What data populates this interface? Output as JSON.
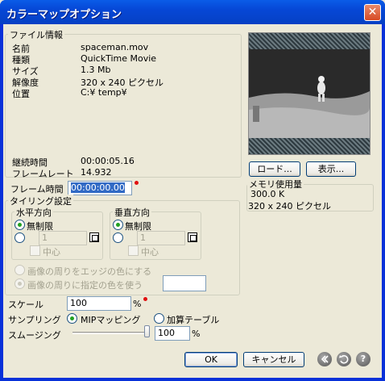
{
  "window": {
    "title": "カラーマップオプション",
    "close_glyph": "✕"
  },
  "file_info": {
    "legend": "ファイル情報",
    "rows": [
      {
        "label": "名前",
        "value": "spaceman.mov"
      },
      {
        "label": "種類",
        "value": "QuickTime Movie"
      },
      {
        "label": "サイズ",
        "value": "1.3 Mb"
      },
      {
        "label": "解像度",
        "value": "320 x 240 ピクセル"
      },
      {
        "label": "位置",
        "value": "C:¥ temp¥"
      }
    ],
    "duration_label": "継続時間",
    "duration_value": "00:00:05.16",
    "framerate_label": "フレームレート",
    "framerate_value": "14.932"
  },
  "preview": {
    "load_label": "ロード...",
    "show_label": "表示..."
  },
  "memory": {
    "legend": "メモリ使用量",
    "amount": "300.0 K",
    "size": "320 x 240 ピクセル"
  },
  "frame_time": {
    "label": "フレーム時間",
    "value": "00:00:00.00"
  },
  "tiling": {
    "legend": "タイリング設定",
    "horizontal": {
      "legend": "水平方向",
      "unlimited_label": "無制限",
      "count_value": "1",
      "center_label": "中心"
    },
    "vertical": {
      "legend": "垂直方向",
      "unlimited_label": "無制限",
      "count_value": "1",
      "center_label": "中心"
    },
    "edge_color_label": "画像の周りをエッジの色にする",
    "custom_color_label": "画像の周りに指定の色を使う"
  },
  "scale": {
    "label": "スケール",
    "value": "100",
    "unit": "%"
  },
  "sampling": {
    "label": "サンプリング",
    "mip_label": "MIPマッピング",
    "add_table_label": "加算テーブル"
  },
  "smoothing": {
    "label": "スムージング",
    "value": "100",
    "unit": "%",
    "level": 100
  },
  "footer": {
    "ok_label": "OK",
    "cancel_label": "キャンセル",
    "help_glyph": "?"
  },
  "colors": {
    "title_bar": "#0a5ce8",
    "required_dot": "#e01010",
    "radio_on": "#21a121"
  }
}
